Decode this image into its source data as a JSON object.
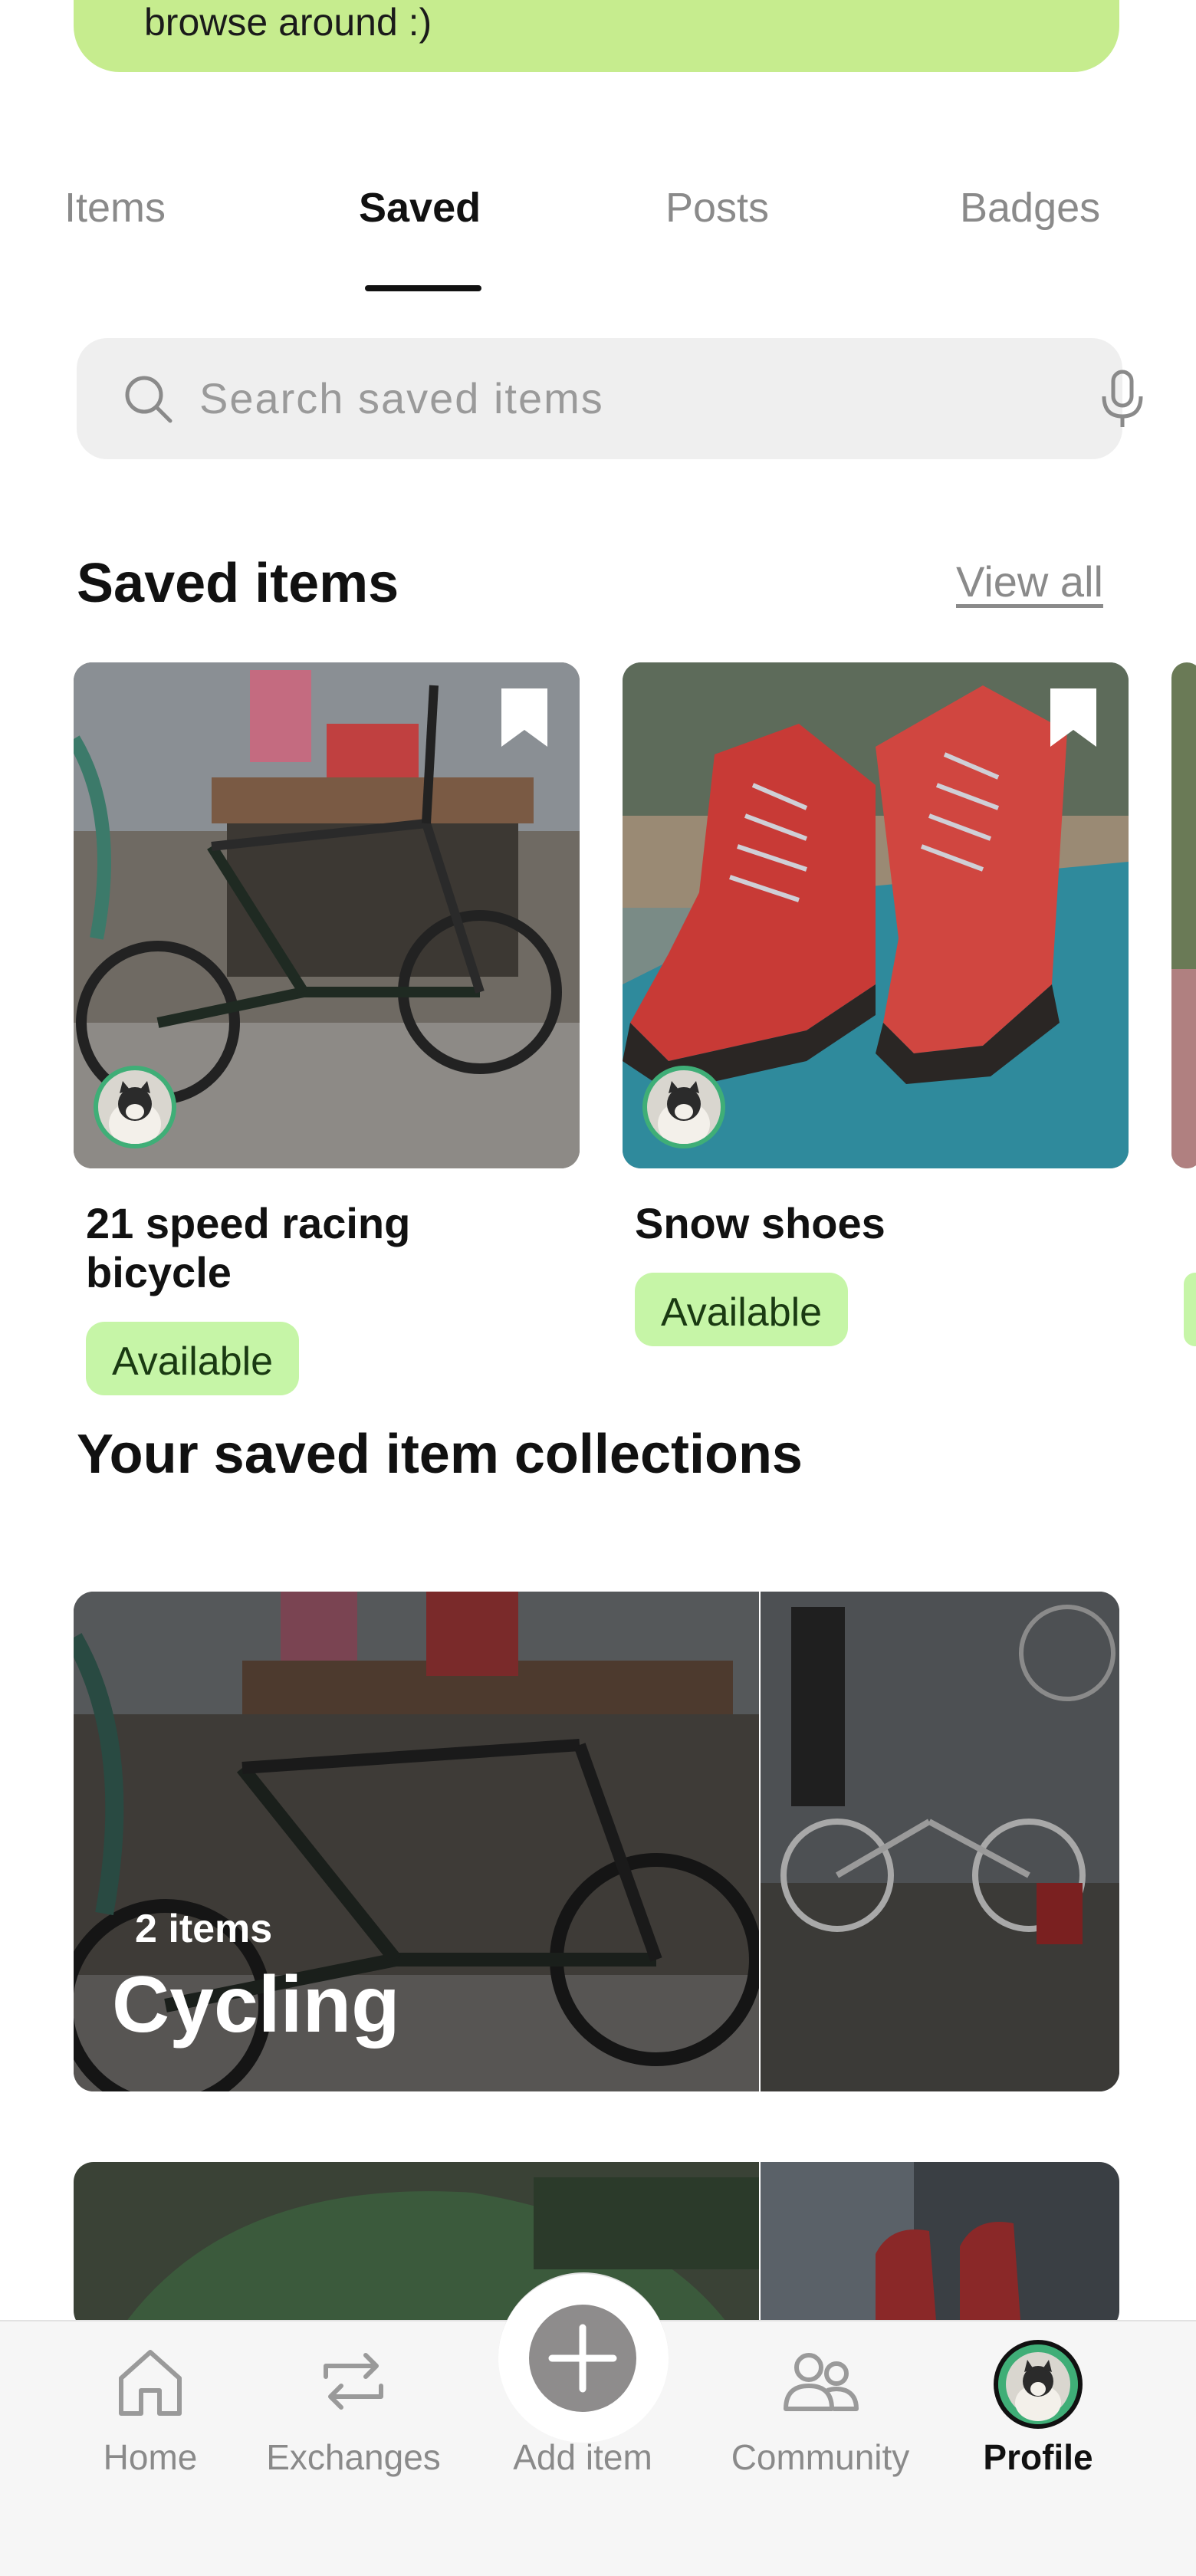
{
  "banner": {
    "text": "browse around :)"
  },
  "tabs": [
    {
      "label": "Items",
      "active": false
    },
    {
      "label": "Saved",
      "active": true
    },
    {
      "label": "Posts",
      "active": false
    },
    {
      "label": "Badges",
      "active": false
    }
  ],
  "search": {
    "placeholder": "Search saved items",
    "icon": "search-icon",
    "mic_icon": "microphone-icon"
  },
  "saved_items": {
    "title": "Saved items",
    "view_all": "View all",
    "items": [
      {
        "title": "21 speed racing bicycle",
        "status": "Available"
      },
      {
        "title": "Snow shoes",
        "status": "Available"
      }
    ]
  },
  "collections": {
    "title": "Your saved item collections",
    "items": [
      {
        "count": "2 items",
        "name": "Cycling"
      }
    ]
  },
  "bottom_nav": [
    {
      "label": "Home",
      "icon": "home-icon",
      "active": false
    },
    {
      "label": "Exchanges",
      "icon": "exchange-arrows-icon",
      "active": false
    },
    {
      "label": "Add item",
      "icon": "plus-icon",
      "active": false
    },
    {
      "label": "Community",
      "icon": "people-icon",
      "active": false
    },
    {
      "label": "Profile",
      "icon": "profile-avatar-icon",
      "active": true
    }
  ],
  "colors": {
    "accent_green": "#c6ec8e",
    "badge_green": "#c6f5a7",
    "avatar_green": "#3fae77"
  }
}
